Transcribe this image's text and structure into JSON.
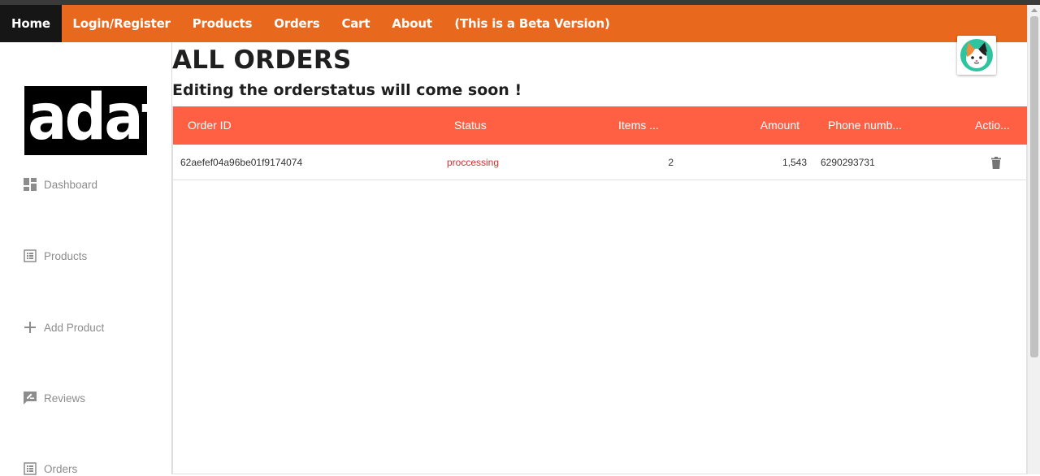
{
  "nav": {
    "items": [
      {
        "label": "Home",
        "active": true
      },
      {
        "label": "Login/Register"
      },
      {
        "label": "Products"
      },
      {
        "label": "Orders"
      },
      {
        "label": "Cart"
      },
      {
        "label": "About"
      },
      {
        "label": "(This is a Beta Version)"
      }
    ]
  },
  "sidebar": {
    "logo_text": "adat",
    "items": [
      {
        "label": "Dashboard",
        "icon": "dashboard-icon"
      },
      {
        "label": "Products",
        "icon": "list-icon"
      },
      {
        "label": "Add Product",
        "icon": "plus-icon"
      },
      {
        "label": "Reviews",
        "icon": "rate-review-icon"
      },
      {
        "label": "Orders",
        "icon": "list-icon"
      }
    ]
  },
  "main": {
    "title": "ALL ORDERS",
    "subtitle": "Editing the orderstatus will come soon !"
  },
  "table": {
    "headers": [
      "Order ID",
      "Status",
      "Items ...",
      "Amount",
      "Phone numb...",
      "Actio..."
    ],
    "rows": [
      {
        "order_id": "62aefef04a96be01f9174074",
        "status": "proccessing",
        "items": "2",
        "amount": "1,543",
        "phone": "6290293731",
        "action_icon": "delete-icon"
      }
    ]
  },
  "colors": {
    "navbar": "#e8681e",
    "active_nav": "#161616",
    "table_header": "#ff5f43",
    "status_processing": "#d32f2f"
  }
}
